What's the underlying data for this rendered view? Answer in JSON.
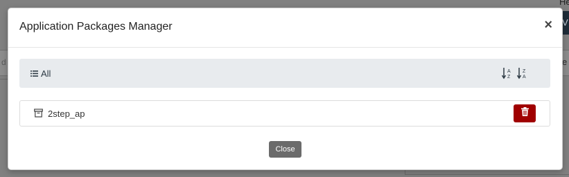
{
  "background": {
    "topright_text": "He",
    "topright_button": "V",
    "left_field_text": "d",
    "right_field_text": "e"
  },
  "modal": {
    "title": "Application Packages Manager",
    "close_x": "×",
    "filter": {
      "label": "All",
      "icon": "list-icon"
    },
    "sort": {
      "asc_icon": "sort-alpha-asc-icon",
      "desc_icon": "sort-alpha-desc-icon"
    },
    "items": [
      {
        "name": "2step_ap",
        "icon": "archive-icon",
        "delete_icon": "trash-icon"
      }
    ],
    "footer": {
      "close_label": "Close"
    }
  },
  "colors": {
    "overlay": "#808080",
    "delete": "#a00000",
    "close_button": "#6b6b6b",
    "toolbar": "#e8ebee"
  }
}
